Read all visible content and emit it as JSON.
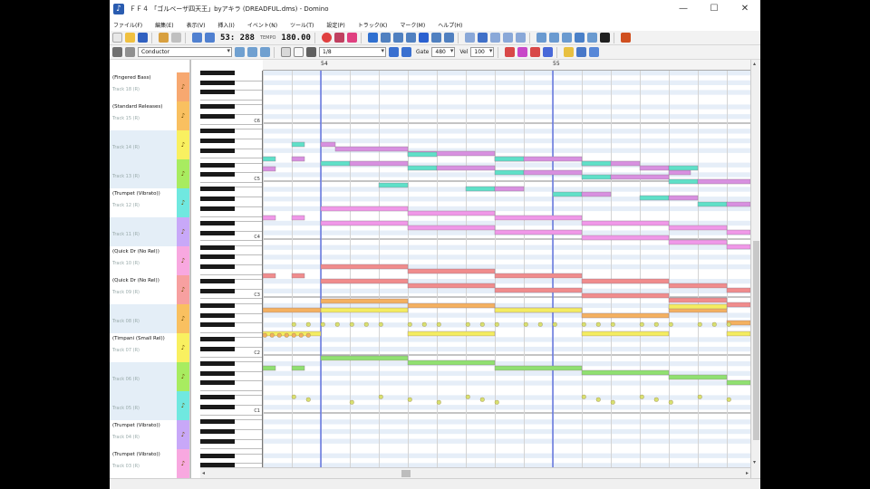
{
  "window": {
    "title": "ＦＦ４ 「ゴルベーザ四天王」byアキラ (DREADFUL.dms) - Domino",
    "controls": [
      "—",
      "☐",
      "✕"
    ]
  },
  "menu": [
    "ファイル(F)",
    "編集(E)",
    "表示(V)",
    "挿入(I)",
    "イベント(N)",
    "ツール(T)",
    "設定(P)",
    "トラック(K)",
    "マーク(M)",
    "ヘルプ(H)"
  ],
  "toolbar": {
    "position": "53: 288",
    "tempo_label": "TEMPO",
    "tempo": "180.00",
    "conductor": "Conductor",
    "mode": "1/8",
    "gate_label": "Gate",
    "gate": "480",
    "vel_label": "Vel",
    "vel": "100"
  },
  "ruler": {
    "measures": [
      "54",
      "55"
    ]
  },
  "keyboard": {
    "octaves": [
      "C6",
      "C5",
      "C4",
      "C3",
      "C2",
      "C1"
    ]
  },
  "tracks": [
    {
      "name": "(Fingered Bass)",
      "sub": "Track 18 (R)",
      "color": "#f7a870"
    },
    {
      "name": "(Standard Releases)",
      "sub": "Track 15 (R)",
      "color": "#f9c060"
    },
    {
      "name": "",
      "sub": "Track 14 (R)",
      "color": "#f9f060"
    },
    {
      "name": "",
      "sub": "Track 13 (R)",
      "color": "#a8ec60"
    },
    {
      "name": "(Trumpet (Vibrato))",
      "sub": "Track 12 (R)",
      "color": "#70e8e0"
    },
    {
      "name": "",
      "sub": "Track 11 (R)",
      "color": "#c8a8f8"
    },
    {
      "name": "(Quick Dr (No Rel))",
      "sub": "Track 10 (R)",
      "color": "#f8a8e0"
    },
    {
      "name": "(Quick Dr (No Rel))",
      "sub": "Track 09 (R)",
      "color": "#f7a0a0"
    },
    {
      "name": "",
      "sub": "Track 08 (R)",
      "color": "#f9c060"
    },
    {
      "name": "(Timpani (Small Rel))",
      "sub": "Track 07 (R)",
      "color": "#f9f060"
    },
    {
      "name": "",
      "sub": "Track 06 (R)",
      "color": "#a8ec60"
    },
    {
      "name": "",
      "sub": "Track 05 (R)",
      "color": "#70e8e0"
    },
    {
      "name": "(Trumpet (Vibrato))",
      "sub": "Track 04 (R)",
      "color": "#c8a8f8"
    },
    {
      "name": "(Trumpet (Vibrato))",
      "sub": "Track 03 (R)",
      "color": "#f8a8e0"
    }
  ],
  "note_colors": {
    "cyan": "#5fe0c8",
    "violet": "#d890e0",
    "pink": "#f098e8",
    "salmon": "#f08c8c",
    "orange": "#f4b060",
    "yellow": "#f4ec60",
    "green": "#90e070",
    "olive": "#d8e070"
  },
  "playhead_color": "#5b6ee0"
}
